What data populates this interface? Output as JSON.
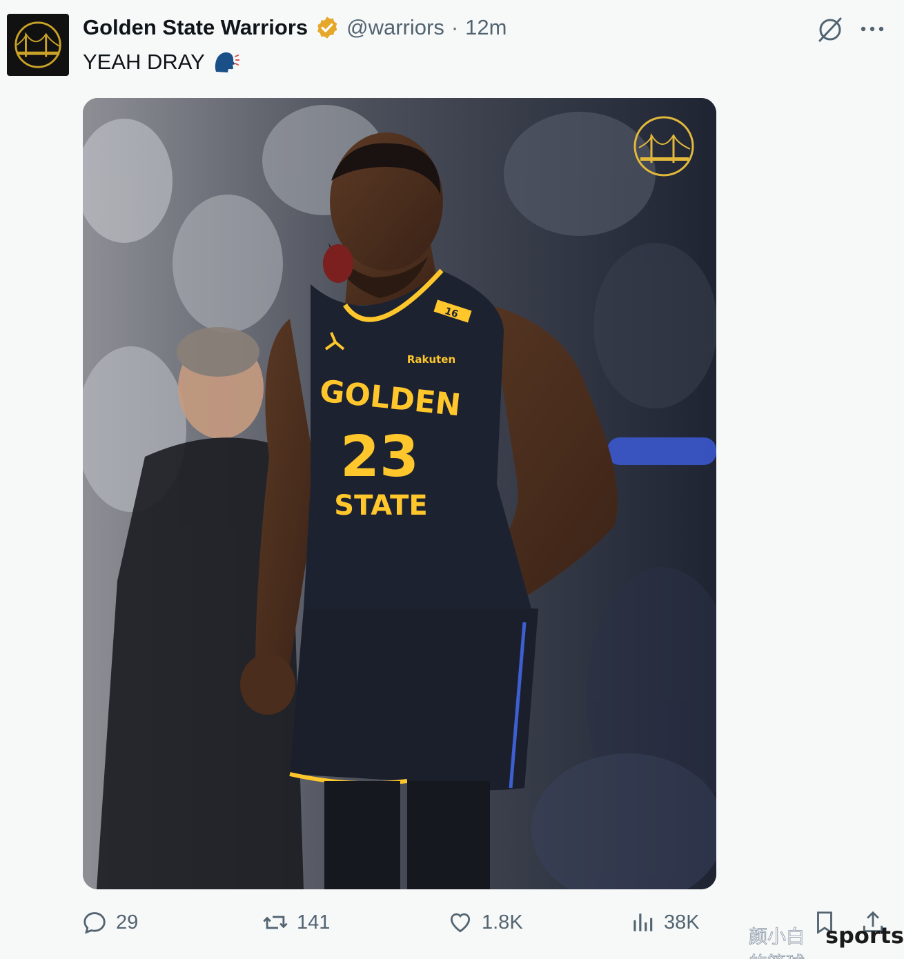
{
  "account": {
    "display_name": "Golden State Warriors",
    "handle": "@warriors",
    "separator": "·",
    "time": "12m",
    "verified": true,
    "avatar": "warriors-bridge-logo"
  },
  "tweet": {
    "text": "YEAH DRAY",
    "emoji": "speaking-head"
  },
  "media": {
    "jersey_top": "GOLDEN",
    "jersey_number": "23",
    "jersey_bottom": "STATE",
    "jersey_sponsor": "Rakuten",
    "strap_number": "16",
    "corner_logo": "warriors-bridge-logo"
  },
  "actions": {
    "replies": "29",
    "reposts": "141",
    "likes": "1.8K",
    "views": "38K"
  },
  "watermark": {
    "chinese": "颜小白的篮球梦",
    "brand": "sports"
  },
  "colors": {
    "text_primary": "#0f1419",
    "text_secondary": "#536471",
    "warriors_gold": "#ffc72c",
    "jersey_navy": "#1d2230"
  }
}
